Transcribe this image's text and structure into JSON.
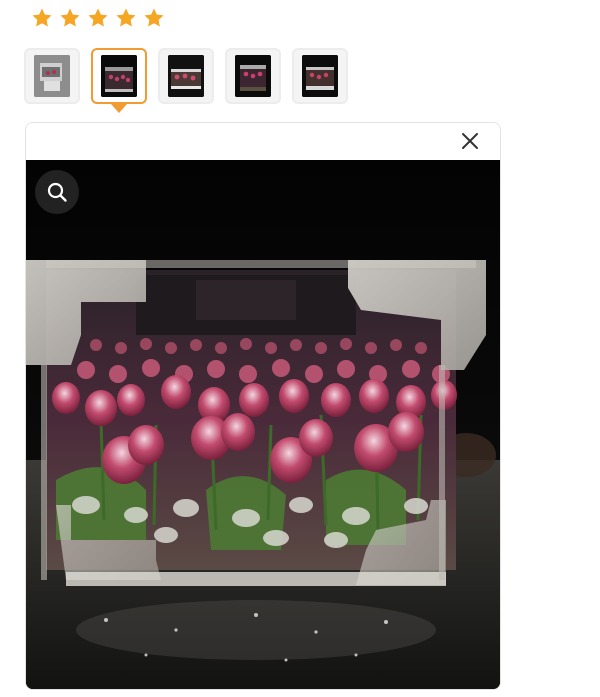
{
  "rating": {
    "stars": 5,
    "star_color": "#f5a623"
  },
  "gallery": {
    "thumbnails": [
      {
        "icon": "product-photo-thumbnail",
        "selected": false
      },
      {
        "icon": "product-photo-thumbnail",
        "selected": true
      },
      {
        "icon": "product-photo-thumbnail",
        "selected": false
      },
      {
        "icon": "product-photo-thumbnail",
        "selected": false
      },
      {
        "icon": "product-photo-thumbnail",
        "selected": false
      }
    ],
    "accent_color": "#f29b32"
  },
  "viewer": {
    "close_icon": "close-icon",
    "zoom_icon": "magnifier-icon",
    "image_subject": "tulip-mirror-night-light"
  }
}
